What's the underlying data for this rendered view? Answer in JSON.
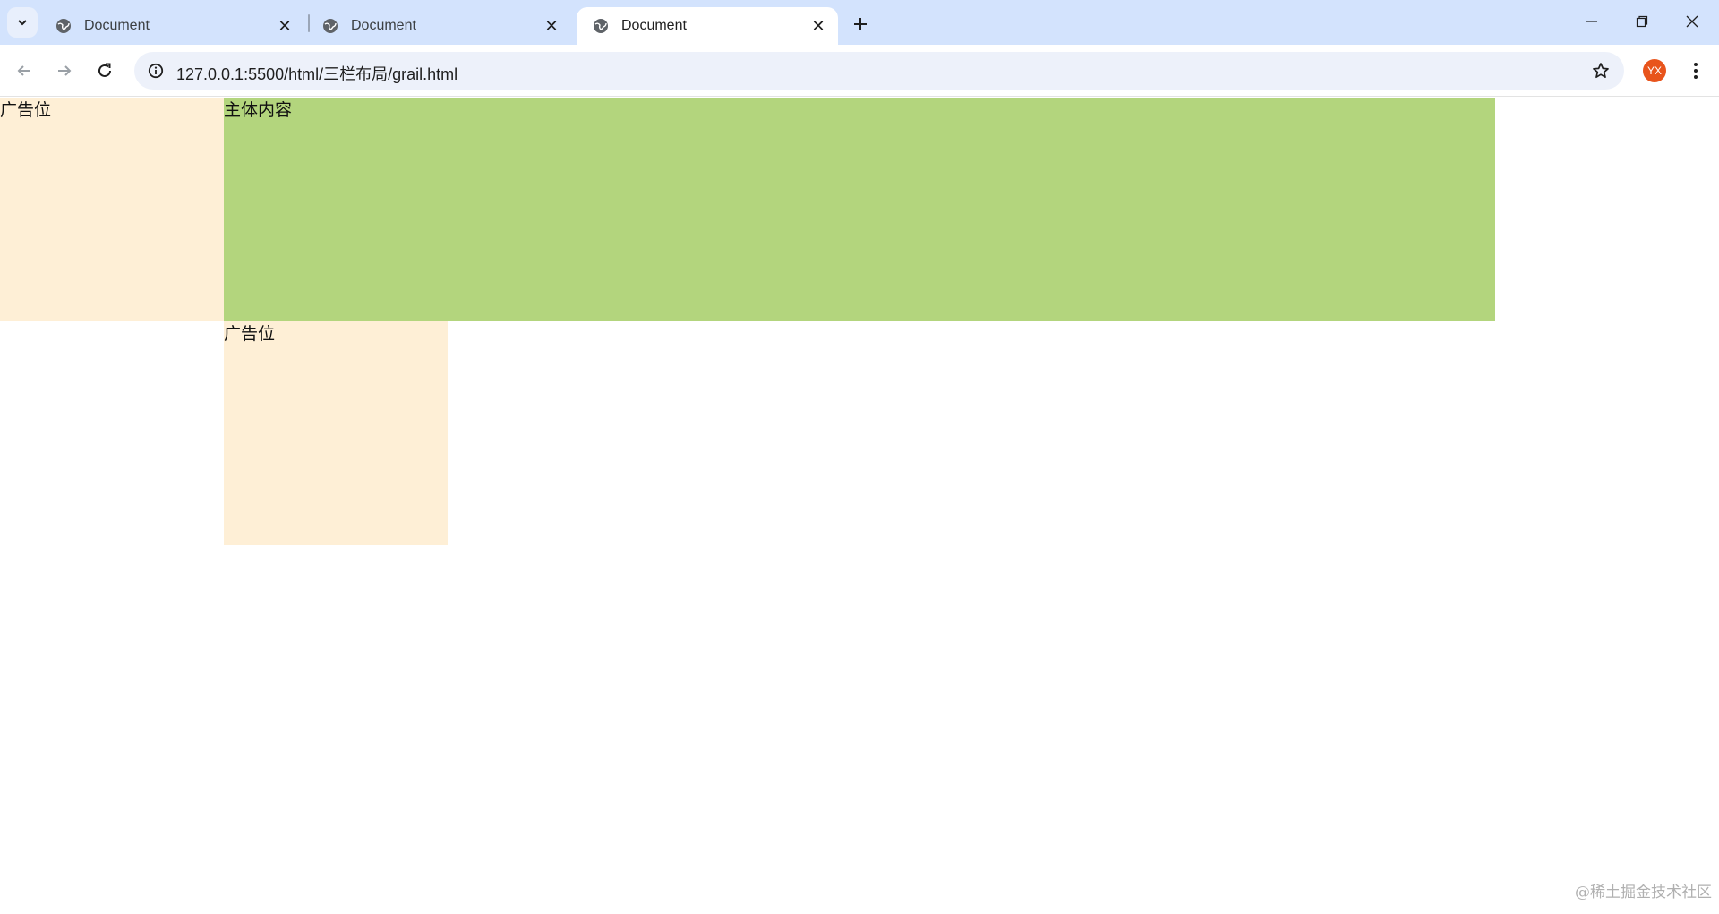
{
  "browser": {
    "tabs": [
      {
        "title": "Document",
        "active": false
      },
      {
        "title": "Document",
        "active": false
      },
      {
        "title": "Document",
        "active": true
      }
    ],
    "address": {
      "url": "127.0.0.1:5500/html/三栏布局/grail.html"
    },
    "profile": {
      "initials": "YX",
      "color": "#e8541c"
    }
  },
  "page": {
    "left_ad": "广告位",
    "main": "主体内容",
    "right_ad": "广告位",
    "colors": {
      "ad_bg": "#feefd6",
      "main_bg": "#b3d57d"
    }
  },
  "watermark": "@稀土掘金技术社区"
}
